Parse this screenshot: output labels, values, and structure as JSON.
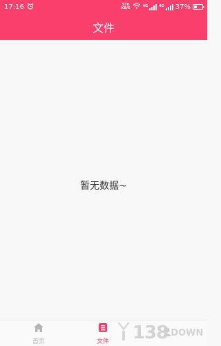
{
  "status_bar": {
    "time": "17:16",
    "net_speed_value": "570",
    "net_speed_unit": "KB/S",
    "signal_1_label": "4G",
    "signal_2_label": "4G",
    "battery": "37%",
    "battery_level": 0.37,
    "icons": [
      "alarm-icon",
      "wifi-icon",
      "signal-icon",
      "signal-icon",
      "battery-icon"
    ]
  },
  "header": {
    "title": "文件"
  },
  "main": {
    "empty_message": "暂无数据~"
  },
  "tab_bar": {
    "tabs": [
      {
        "label": "首页",
        "icon": "home-icon",
        "active": false
      },
      {
        "label": "文件",
        "icon": "file-list-icon",
        "active": true
      },
      {
        "label": "",
        "icon": "user-icon",
        "active": false
      }
    ]
  },
  "watermark": {
    "number": "138",
    "suffix": "DOWN"
  },
  "colors": {
    "accent": "#fb3f6c",
    "inactive": "#b5b5b5",
    "background": "#f8f8f8"
  }
}
